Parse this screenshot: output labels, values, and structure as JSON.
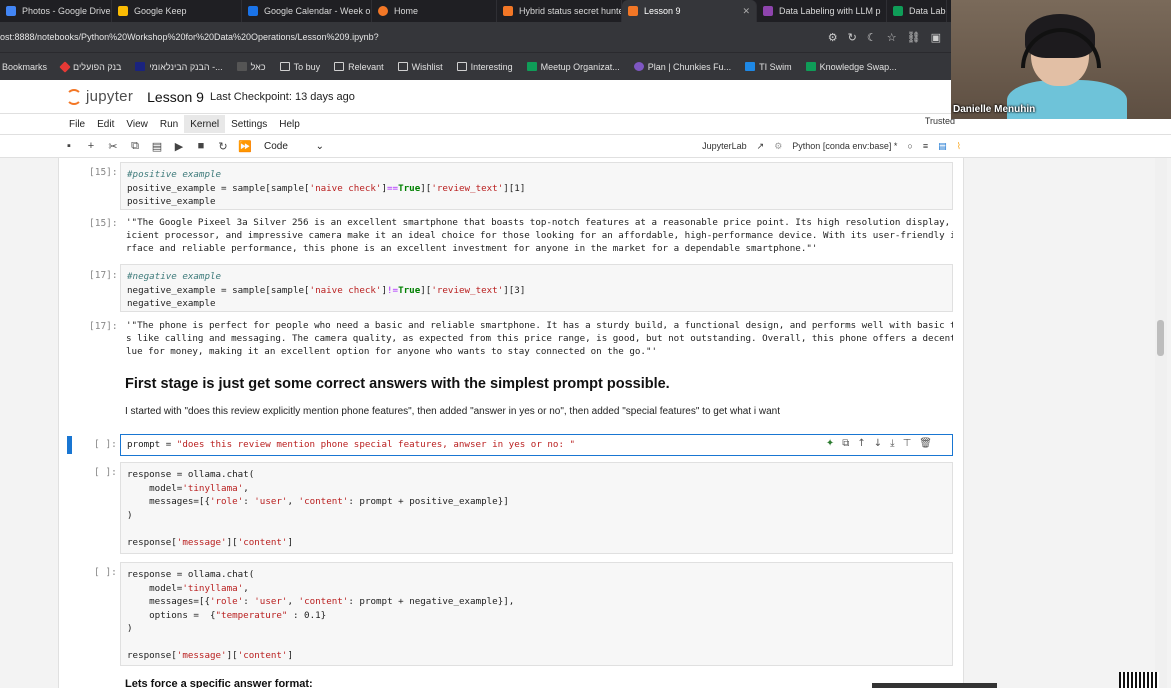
{
  "tabs": [
    {
      "label": "Photos - Google Drive",
      "color": "#4285f4"
    },
    {
      "label": "Google Keep",
      "color": "#fbbc04"
    },
    {
      "label": "Google Calendar - Week o",
      "color": "#1a73e8"
    },
    {
      "label": "Home",
      "color": "#f37726"
    },
    {
      "label": "Hybrid status secret hunte",
      "color": "#f37726"
    },
    {
      "label": "Lesson 9",
      "color": "#f37726"
    },
    {
      "label": "Data Labeling with LLM p",
      "color": "#8e44ad"
    },
    {
      "label": "Data Label",
      "color": "#0f9d58"
    }
  ],
  "address": {
    "url": "ost:8888/notebooks/Python%20Workshop%20for%20Data%20Operations/Lesson%209.ipynb?"
  },
  "bookmarks": [
    {
      "label": "Bookmarks",
      "kind": "folder"
    },
    {
      "label": "בנק הפועלים",
      "kind": "site"
    },
    {
      "label": "הבנק הבינלאומי -...",
      "kind": "site"
    },
    {
      "label": "כאל",
      "kind": "site"
    },
    {
      "label": "To buy",
      "kind": "folder"
    },
    {
      "label": "Relevant",
      "kind": "folder"
    },
    {
      "label": "Wishlist",
      "kind": "folder"
    },
    {
      "label": "Interesting",
      "kind": "folder"
    },
    {
      "label": "Meetup Organizat...",
      "kind": "site"
    },
    {
      "label": "Plan | Chunkies Fu...",
      "kind": "site"
    },
    {
      "label": "TI Swim",
      "kind": "site"
    },
    {
      "label": "Knowledge Swap...",
      "kind": "site"
    }
  ],
  "jupyter": {
    "logo_text": "jupyter",
    "notebook_title": "Lesson 9",
    "checkpoint": "Last Checkpoint: 13 days ago",
    "trusted": "Trusted",
    "menu": [
      "File",
      "Edit",
      "View",
      "Run",
      "Kernel",
      "Settings",
      "Help"
    ],
    "active_menu": "Kernel",
    "celltype": "Code",
    "jupyterlab_label": "JupyterLab",
    "kernel_label": "Python [conda env:base] *"
  },
  "cells": {
    "c1_prompt": "[15]:",
    "c1_out_prompt": "[15]:",
    "c2_prompt": "[17]:",
    "c2_out_prompt": "[17]:",
    "empty_prompt": "[ ]:",
    "out1_lines": [
      "'\"The Google Pixeel 3a Silver 256 is an excellent smartphone that boasts top-notch features at a reasonable price point. Its high resolution display, eff",
      "icient processor, and impressive camera make it an ideal choice for those looking for an affordable, high-performance device. With its user-friendly inte",
      "rface and reliable performance, this phone is an excellent investment for anyone in the market for a dependable smartphone.\"'"
    ],
    "out2_lines": [
      "'\"The phone is perfect for people who need a basic and reliable smartphone. It has a sturdy build, a functional design, and performs well with basic task",
      "s like calling and messaging. The camera quality, as expected from this price range, is good, but not outstanding. Overall, this phone offers a decent va",
      "lue for money, making it an excellent option for anyone who wants to stay connected on the go.\"'"
    ],
    "heading": "First stage is just get some correct answers with the simplest prompt possible.",
    "paragraph": "I started with \"does this review explicitly mention phone features\", then added \"answer in yes or no\", then added \"special features\" to get what i want",
    "bottom_heading": "Lets force a specific answer format:"
  },
  "webcam": {
    "name": "Danielle Menuhin"
  }
}
